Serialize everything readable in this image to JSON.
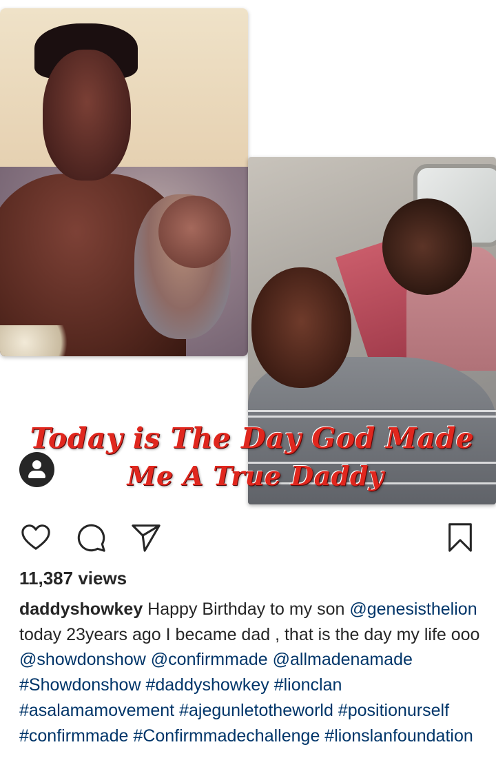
{
  "post": {
    "overlay_line1": "Today is The Day God Made",
    "overlay_line2": "Me A True Daddy",
    "views": "11,387 views",
    "caption": {
      "username": "daddyshowkey",
      "text1": " Happy Birthday to my son ",
      "mention1": "@genesisthelion",
      "text2": " today 23years ago I became dad , that is the day my life ooo ",
      "mention2": "@showdonshow",
      "mention3": "@confirmmade",
      "mention4": "@allmadenamade",
      "hashtag1": "#Showdonshow",
      "hashtag2": "#daddyshowkey",
      "hashtag3": "#lionclan",
      "hashtag4": "#asalamamovement",
      "hashtag5": "#ajegunletotheworld",
      "hashtag6": "#positionurself",
      "hashtag7": "#confirmmade",
      "hashtag8": "#Confirmmadechallenge",
      "hashtag9": "#lionslanfoundation"
    }
  },
  "icons": {
    "like": "heart-icon",
    "comment": "comment-icon",
    "share": "send-icon",
    "save": "bookmark-icon",
    "tagged_user": "user-icon"
  },
  "colors": {
    "text": "#262626",
    "link": "#003569",
    "overlay_red": "#e0271e"
  }
}
